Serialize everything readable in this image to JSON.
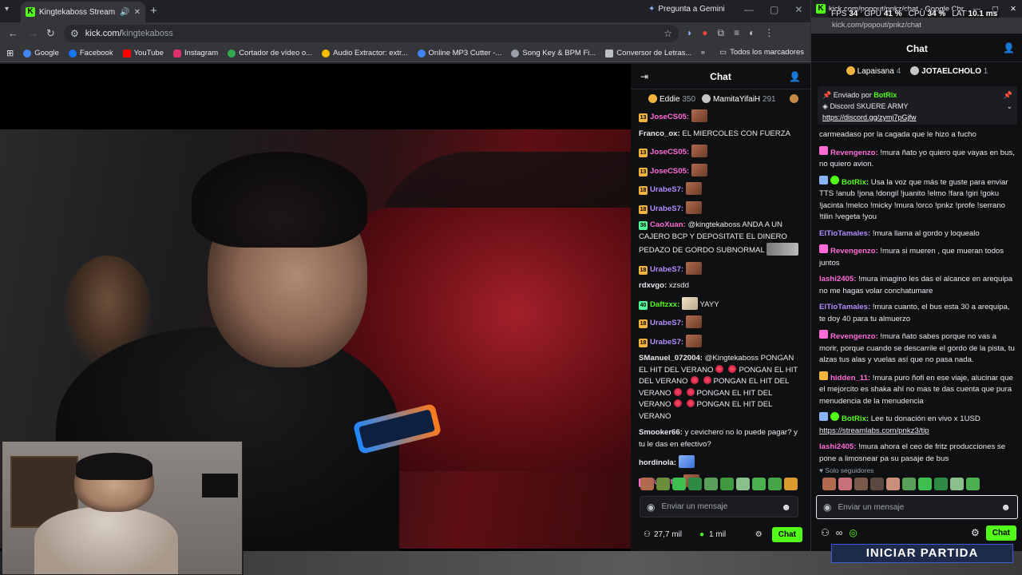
{
  "browser": {
    "tab_title": "Kingtekaboss Stream - Wat",
    "gemini_label": "Pregunta a Gemini",
    "url_host": "kick.com/",
    "url_path": "kingtekaboss",
    "bookmarks": [
      "Google",
      "Facebook",
      "YouTube",
      "Instagram",
      "Cortador de vídeo o...",
      "Audio Extractor: extr...",
      "Online MP3 Cutter -...",
      "Song Key & BPM Fi...",
      "Conversor de Letras..."
    ],
    "bookmarks_all": "Todos los marcadores"
  },
  "chat": {
    "title": "Chat",
    "gifters": [
      {
        "name": "Eddie",
        "count": "350"
      },
      {
        "name": "MamitaYifaiH",
        "count": "291"
      }
    ],
    "messages": [
      {
        "badge": "13",
        "user": "JoseCS05:",
        "text": ""
      },
      {
        "badge": "",
        "user": "Franco_ox:",
        "text": "EL MIERCOLES CON FUERZA"
      },
      {
        "badge": "13",
        "user": "JoseCS05:",
        "text": ""
      },
      {
        "badge": "13",
        "user": "JoseCS05:",
        "text": ""
      },
      {
        "badge": "18",
        "user": "UrabeS7:",
        "text": ""
      },
      {
        "badge": "18",
        "user": "UrabeS7:",
        "text": ""
      },
      {
        "badge": "36",
        "user": "CaoXuan:",
        "text": "@kingtekaboss ANDA A UN CAJERO BCP Y DEPOSITATE EL DINERO PEDAZO DE GORDO SUBNORMAL"
      },
      {
        "badge": "18",
        "user": "UrabeS7:",
        "text": ""
      },
      {
        "badge": "",
        "user": "rdxvgo:",
        "text": "xzsdd"
      },
      {
        "badge": "40",
        "user": "Daftzxx:",
        "text": "YAYY"
      },
      {
        "badge": "18",
        "user": "UrabeS7:",
        "text": ""
      },
      {
        "badge": "18",
        "user": "UrabeS7:",
        "text": ""
      },
      {
        "badge": "",
        "user": "SManuel_072004:",
        "text": "@Kingtekaboss PONGAN EL HIT DEL VERANO"
      },
      {
        "badge": "",
        "user": "Smooker66:",
        "text": "y cevichero no lo puede pagar? y tu le das en efectivo?"
      },
      {
        "badge": "",
        "user": "hordinola:",
        "text": ""
      },
      {
        "badge": "24",
        "user": "Tuquitis:",
        "text": ""
      }
    ],
    "hit_repeat": [
      "PONGAN EL HIT DEL VERANO",
      "PONGAN EL HIT DEL VERANO",
      "PONGAN EL HIT DEL VERANO",
      "PONGAN EL HIT DEL VERANO"
    ],
    "input_placeholder": "Enviar un mensaje",
    "viewers": "27,7 mil",
    "followers": "1 mil",
    "send_label": "Chat"
  },
  "popout": {
    "window_title": "kick.com/popout/pnkz/chat - Google Chr...",
    "url": "kick.com/popout/pnkz/chat",
    "hud": {
      "fps_label": "FPS",
      "fps": "34",
      "gpu_label": "GPU",
      "gpu": "41 %",
      "cpu_label": "CPU",
      "cpu": "34 %",
      "lat_label": "LAT",
      "lat": "10.1 ms"
    },
    "title": "Chat",
    "gifters": [
      {
        "name": "Lapaisana",
        "count": "4"
      },
      {
        "name": "JOTAELCHOLO",
        "count": "1"
      }
    ],
    "pinned": {
      "sent_by": "Enviado por",
      "bot": "BotRix",
      "line1": "Discord SKUERE ARMY",
      "link": "https://discord.gg/zymj7pGjfw"
    },
    "messages": [
      {
        "user": "",
        "text": "carmeadaso por la cagada que le hizo a fucho",
        "color": ""
      },
      {
        "user": "Revengenzo:",
        "text": "!mura ñato yo quiero que vayas en bus, no quiero avion.",
        "color": "#ff6bd6"
      },
      {
        "user": "BotRix:",
        "text": "Usa la voz que más te guste para enviar TTS !anub !jona !dongil !juanito !elmo !fara !giri !goku !jacinta !melco !micky !mura !orco !pnkz !profe !serrano !tilin !vegeta !you",
        "color": "#53fc18"
      },
      {
        "user": "ElTioTamales:",
        "text": "!mura llama al gordo y loquealo",
        "color": "#b48cff"
      },
      {
        "user": "Revengenzo:",
        "text": "!mura si mueren , que mueran todos juntos",
        "color": "#ff6bd6"
      },
      {
        "user": "lashi2405:",
        "text": "!mura imagino les das el alcance en arequipa no me hagas volar conchatumare",
        "color": "#ff6bd6"
      },
      {
        "user": "ElTioTamales:",
        "text": "!mura cuanto, el bus esta 30 a arequipa, te doy 40 para tu almuerzo",
        "color": "#b48cff"
      },
      {
        "user": "Revengenzo:",
        "text": "!mura ñato sabes porque no vas a morir, porque cuando se descarrile el gordo de la pista, tu alzas tus alas y vuelas así que no pasa nada.",
        "color": "#ff6bd6"
      },
      {
        "user": "hidden_11:",
        "text": "!mura puro ñofi en ese viaje, alucinar que el mejorcito es shaka ahí no mas te das cuenta que pura menudencia de la menudencia",
        "color": "#ff6bd6"
      },
      {
        "user": "BotRix:",
        "text": "Lee tu donación en vivo x 1USD",
        "color": "#53fc18",
        "link": "https://streamlabs.com/pnkz3/tip"
      },
      {
        "user": "lashi2405:",
        "text": "!mura ahora el ceo de fritz producciones se pone a limosnear pa su pasaje de bus",
        "color": "#ff6bd6"
      }
    ],
    "followers_only": "Solo seguidores",
    "input_placeholder": "Enviar un mensaje",
    "send_label": "Chat"
  },
  "overlay": {
    "start_label": "INICIAR PARTIDA"
  },
  "colors": {
    "kick_green": "#53fc18",
    "chat_bg": "#0f1012"
  }
}
